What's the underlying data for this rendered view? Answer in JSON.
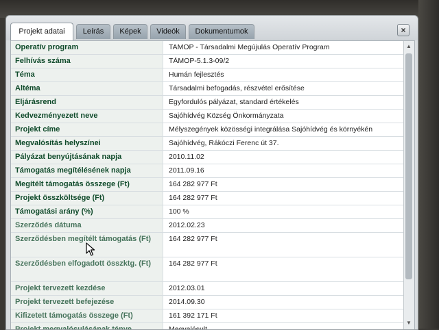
{
  "tabs": [
    {
      "label": "Projekt adatai",
      "active": true
    },
    {
      "label": "Leírás",
      "active": false
    },
    {
      "label": "Képek",
      "active": false
    },
    {
      "label": "Videók",
      "active": false
    },
    {
      "label": "Dokumentumok",
      "active": false
    }
  ],
  "close": {
    "icon": "close-icon",
    "symbol": "×"
  },
  "rows": [
    {
      "label": "Operatív program",
      "value": "TAMOP - Társadalmi Megújulás Operatív Program"
    },
    {
      "label": "Felhívás száma",
      "value": "TÁMOP-5.1.3-09/2"
    },
    {
      "label": "Téma",
      "value": "Humán fejlesztés"
    },
    {
      "label": "Altéma",
      "value": "Társadalmi befogadás, részvétel erősítése"
    },
    {
      "label": "Eljárásrend",
      "value": "Egyfordulós pályázat, standard értékelés"
    },
    {
      "label": "Kedvezményezett neve",
      "value": "Sajóhídvég Község Önkormányzata"
    },
    {
      "label": "Projekt címe",
      "value": "Mélyszegények közösségi integrálása Sajóhídvég és környékén"
    },
    {
      "label": "Megvalósítás helyszínei",
      "value": "Sajóhídvég, Rákóczi Ferenc út 37."
    },
    {
      "label": "Pályázat benyújtásának napja",
      "value": "2010.11.02"
    },
    {
      "label": "Támogatás megítélésének napja",
      "value": "2011.09.16"
    },
    {
      "label": "Megítélt támogatás összege (Ft)",
      "value": "164 282 977 Ft"
    },
    {
      "label": "Projekt összköltsége (Ft)",
      "value": "164 282 977 Ft"
    },
    {
      "label": "Támogatási arány (%)",
      "value": "100 %"
    },
    {
      "label": "Szerződés dátuma",
      "value": "2012.02.23"
    },
    {
      "label": "Szerződésben megítélt támogatás (Ft)",
      "value": "164 282 977 Ft",
      "tall": true
    },
    {
      "label": "Szerződésben elfogadott összktg. (Ft)",
      "value": "164 282 977 Ft",
      "tall": true
    },
    {
      "label": "Projekt tervezett kezdése",
      "value": "2012.03.01"
    },
    {
      "label": "Projekt tervezett befejezése",
      "value": "2014.09.30"
    },
    {
      "label": "Kifizetett támogatás összege (Ft)",
      "value": "161 392 171 Ft"
    },
    {
      "label": "Projekt megvalósulásának ténye",
      "value": "Megvalósult"
    }
  ],
  "colors": {
    "label_text": "#0f4a2a",
    "label_bg": "#edf1ee",
    "tab_bg": "#97a3ad",
    "dialog_bg": "#d9dde0"
  }
}
